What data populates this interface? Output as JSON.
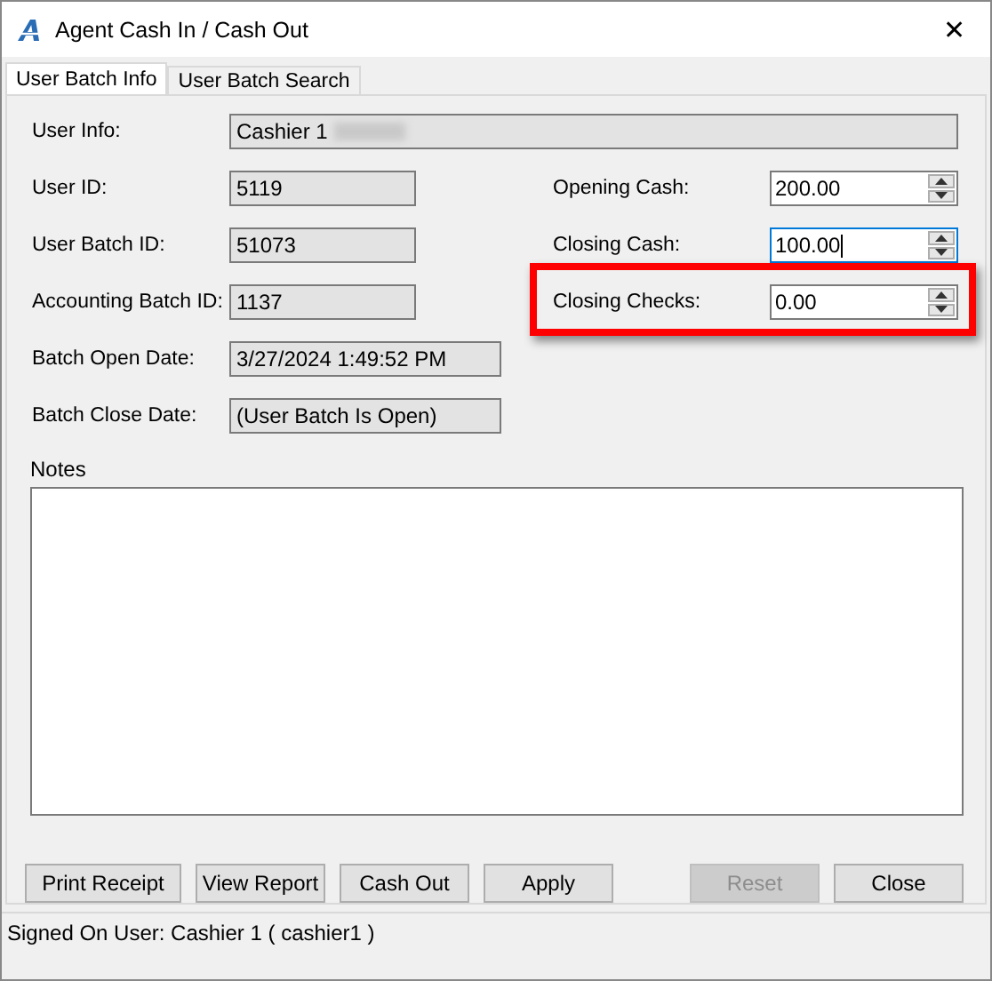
{
  "window": {
    "title": "Agent Cash In / Cash Out",
    "close": "✕"
  },
  "tabs": [
    {
      "label": "User Batch Info",
      "selected": true
    },
    {
      "label": "User Batch Search",
      "selected": false
    }
  ],
  "user_info": {
    "label": "User Info:",
    "value": "Cashier 1"
  },
  "left_fields": [
    {
      "label": "User ID:",
      "value": "5119",
      "kind": "short"
    },
    {
      "label": "User Batch ID:",
      "value": "51073",
      "kind": "short"
    },
    {
      "label": "Accounting Batch ID:",
      "value": "1137",
      "kind": "short"
    },
    {
      "label": "Batch Open Date:",
      "value": "3/27/2024 1:49:52 PM",
      "kind": "long"
    },
    {
      "label": "Batch Close Date:",
      "value": "(User Batch Is Open)",
      "kind": "long"
    }
  ],
  "right_fields": [
    {
      "label": "Opening Cash:",
      "value": "200.00",
      "focused": false,
      "highlighted": false
    },
    {
      "label": "Closing Cash:",
      "value": "100.00",
      "focused": true,
      "highlighted": false
    },
    {
      "label": "Closing Checks:",
      "value": "0.00",
      "focused": false,
      "highlighted": true
    }
  ],
  "notes": {
    "label": "Notes"
  },
  "buttons": [
    {
      "label": "Print Receipt",
      "disabled": false
    },
    {
      "label": "View Report",
      "disabled": false
    },
    {
      "label": "Cash Out",
      "disabled": false
    },
    {
      "label": "Apply",
      "disabled": false
    },
    {
      "label": "Reset",
      "disabled": true
    },
    {
      "label": "Close",
      "disabled": false
    }
  ],
  "status_bar": "Signed On User: Cashier 1 ( cashier1 )"
}
